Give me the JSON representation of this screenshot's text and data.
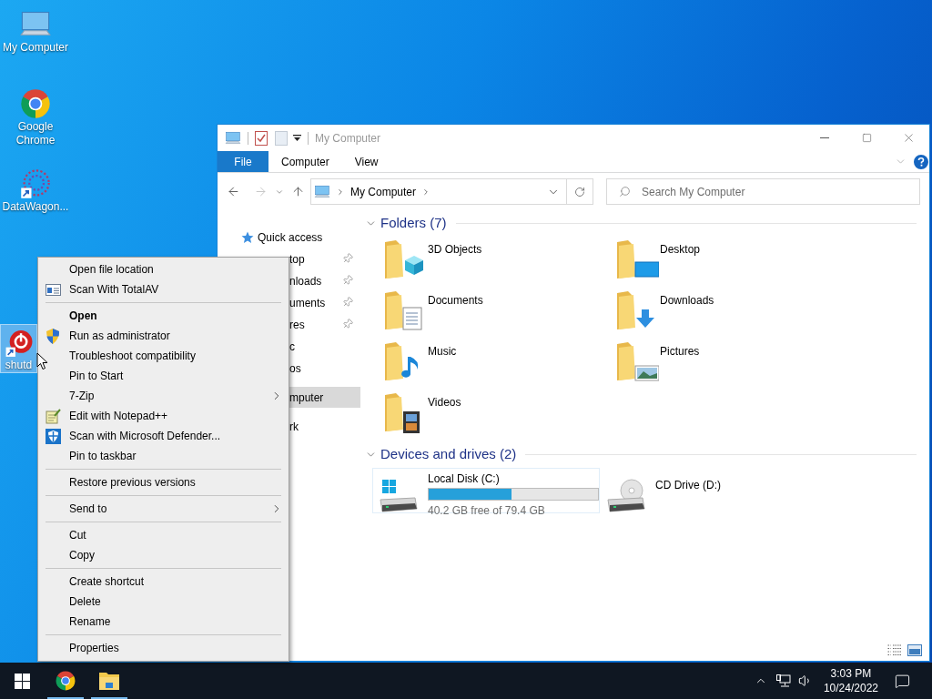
{
  "desktop_icons": [
    {
      "label": "My Computer",
      "kind": "computer",
      "selected": false
    },
    {
      "label": "Google Chrome",
      "kind": "chrome",
      "selected": false
    },
    {
      "label": "DataWagon...",
      "kind": "spiral",
      "selected": false
    },
    {
      "label": "shutd",
      "kind": "power",
      "selected": true
    }
  ],
  "explorer": {
    "title": "My Computer",
    "ribbon_tabs": [
      {
        "label": "File",
        "kind": "file"
      },
      {
        "label": "Computer",
        "kind": "tab"
      },
      {
        "label": "View",
        "kind": "tab"
      }
    ],
    "address": {
      "crumbs": [
        "My Computer"
      ]
    },
    "search": {
      "placeholder": "Search My Computer"
    },
    "nav_pane": [
      {
        "label": "Quick access",
        "kind": "star",
        "selected": false,
        "children": [
          {
            "label": "top",
            "pinned": true,
            "selected": false
          },
          {
            "label": "nloads",
            "pinned": true,
            "selected": false
          },
          {
            "label": "uments",
            "pinned": true,
            "selected": false
          },
          {
            "label": "res",
            "pinned": true,
            "selected": false
          },
          {
            "label": "c",
            "pinned": false,
            "selected": false
          },
          {
            "label": "os",
            "pinned": false,
            "selected": false
          }
        ]
      },
      {
        "label": "mputer",
        "selected": true
      },
      {
        "label": "rk",
        "selected": false
      }
    ],
    "groups": [
      {
        "title": "Folders (7)",
        "kind": "folders",
        "items": [
          {
            "label": "3D Objects",
            "kind": "cube"
          },
          {
            "label": "Desktop",
            "kind": "desktop"
          },
          {
            "label": "Documents",
            "kind": "document"
          },
          {
            "label": "Downloads",
            "kind": "download"
          },
          {
            "label": "Music",
            "kind": "music"
          },
          {
            "label": "Pictures",
            "kind": "picture"
          },
          {
            "label": "Videos",
            "kind": "video"
          }
        ]
      },
      {
        "title": "Devices and drives (2)",
        "kind": "drives",
        "items": [
          {
            "label": "Local Disk (C:)",
            "kind": "disk",
            "level": 0.49,
            "reading": "40.2 GB free of 79.4 GB"
          },
          {
            "label": "CD Drive (D:)",
            "kind": "cd"
          }
        ]
      }
    ]
  },
  "context_menu": [
    {
      "kind": "item",
      "label": "Open file location"
    },
    {
      "kind": "totalav",
      "label": "Scan With TotalAV"
    },
    {
      "kind": "separator"
    },
    {
      "kind": "item",
      "label": "Open",
      "default": true
    },
    {
      "kind": "uac",
      "label": "Run as administrator"
    },
    {
      "kind": "item",
      "label": "Troubleshoot compatibility"
    },
    {
      "kind": "item",
      "label": "Pin to Start"
    },
    {
      "kind": "item",
      "label": "7-Zip",
      "submenu": true
    },
    {
      "kind": "notepad",
      "label": "Edit with Notepad++"
    },
    {
      "kind": "defender",
      "label": "Scan with Microsoft Defender..."
    },
    {
      "kind": "item",
      "label": "Pin to taskbar"
    },
    {
      "kind": "separator"
    },
    {
      "kind": "item",
      "label": "Restore previous versions"
    },
    {
      "kind": "separator"
    },
    {
      "kind": "item",
      "label": "Send to",
      "submenu": true
    },
    {
      "kind": "separator"
    },
    {
      "kind": "item",
      "label": "Cut"
    },
    {
      "kind": "item",
      "label": "Copy"
    },
    {
      "kind": "separator"
    },
    {
      "kind": "item",
      "label": "Create shortcut"
    },
    {
      "kind": "item",
      "label": "Delete"
    },
    {
      "kind": "item",
      "label": "Rename"
    },
    {
      "kind": "separator"
    },
    {
      "kind": "item",
      "label": "Properties"
    }
  ],
  "taskbar": {
    "apps": [
      {
        "kind": "chrome",
        "running": true
      },
      {
        "kind": "explorer",
        "running": true
      }
    ],
    "clock": {
      "time": "3:03 PM",
      "date": "10/24/2022"
    }
  }
}
